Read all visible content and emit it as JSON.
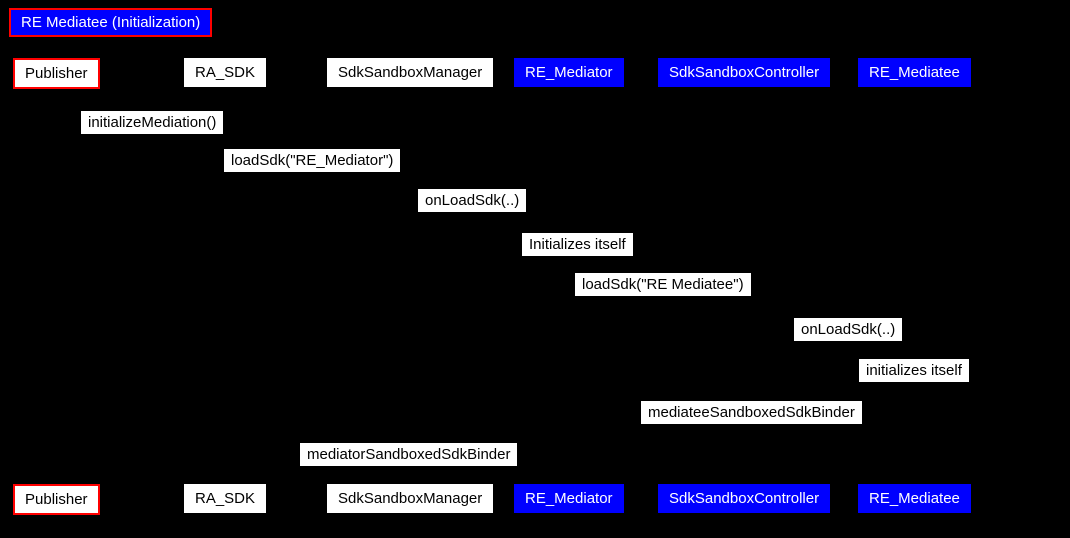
{
  "title": "RE Mediatee (Initialization)",
  "participants": {
    "publisher": "Publisher",
    "ra_sdk": "RA_SDK",
    "sdk_sandbox_manager": "SdkSandboxManager",
    "re_mediator": "RE_Mediator",
    "sdk_sandbox_controller": "SdkSandboxController",
    "re_mediatee": "RE_Mediatee"
  },
  "messages": {
    "m1": "initializeMediation()",
    "m2": "loadSdk(\"RE_Mediator\")",
    "m3": "onLoadSdk(..)",
    "m4": "Initializes itself",
    "m5": "loadSdk(\"RE Mediatee\")",
    "m6": "onLoadSdk(..)",
    "m7": "initializes itself",
    "m8": "mediateeSandboxedSdkBinder",
    "m9": "mediatorSandboxedSdkBinder"
  }
}
